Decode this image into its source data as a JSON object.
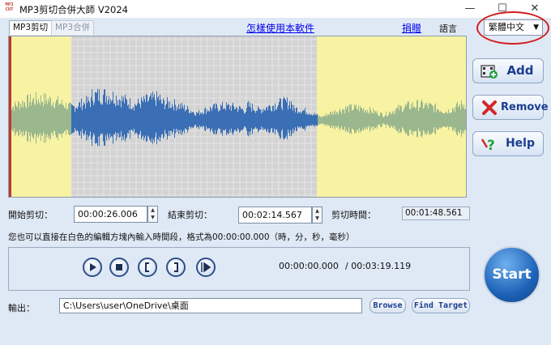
{
  "window": {
    "title": "MP3剪切合併大師 V2024",
    "icon_text": "MP3 CUT",
    "controls": {
      "minimize": "—",
      "maximize": "☐",
      "close": "✕"
    }
  },
  "tabs": [
    {
      "label": "MP3剪切",
      "active": true
    },
    {
      "label": "MP3合併",
      "active": false
    }
  ],
  "links": {
    "howto": "怎樣使用本軟件",
    "donate": "捐贈"
  },
  "language": {
    "label": "語言",
    "selected": "繁體中文",
    "chevron_icon": "chevron-down-icon"
  },
  "side_buttons": [
    {
      "label": "Add",
      "icon": "add-file-icon"
    },
    {
      "label": "Remove",
      "icon": "remove-x-icon"
    },
    {
      "label": "Help",
      "icon": "help-icon"
    }
  ],
  "waveform": {
    "selection_start_fraction": 0.136,
    "selection_end_fraction": 0.674,
    "colors": {
      "outside": "#f7f3a3",
      "inside": "#d3d3d3",
      "wave_selected": "#3a6fb5",
      "wave_outside": "#9bb78e"
    }
  },
  "trim": {
    "start_label": "開始剪切：",
    "start_value": "00:00:26.006",
    "end_label": "結束剪切：",
    "end_value": "00:02:14.567",
    "duration_label": "剪切時間：",
    "duration_value": "00:01:48.561"
  },
  "hint": "您也可以直接在白色的編輯方塊內輸入時間段，格式為00:00:00.000（時，分，秒，毫秒）",
  "player": {
    "buttons": [
      "play-icon",
      "stop-icon",
      "mark-start-icon",
      "mark-end-icon",
      "play-selection-icon"
    ],
    "current_time": "00:00:00.000",
    "total_time": "/ 00:03:19.119"
  },
  "start_button": "Start",
  "output": {
    "label": "輸出：",
    "path": "C:\\Users\\user\\OneDrive\\桌面",
    "browse": "Browse",
    "find_target": "Find Target"
  }
}
